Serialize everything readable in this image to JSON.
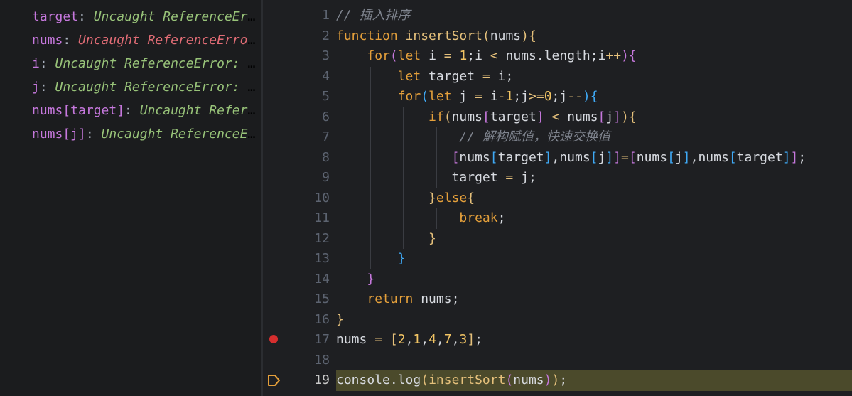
{
  "watch": [
    {
      "name": "target",
      "value": "Uncaught ReferenceError: target is not defined",
      "error": false
    },
    {
      "name": "nums",
      "value": "Uncaught ReferenceError: nums is not defined",
      "error": true
    },
    {
      "name": "i",
      "value": "Uncaught ReferenceError: i is not defined",
      "error": false
    },
    {
      "name": "j",
      "value": "Uncaught ReferenceError: j is not defined",
      "error": false
    },
    {
      "name": "nums[target]",
      "value": "Uncaught ReferenceError: nums is not defined",
      "error": false
    },
    {
      "name": "nums[j]",
      "value": "Uncaught ReferenceError: nums is not defined",
      "error": false
    }
  ],
  "editor": {
    "breakpoint_line": 17,
    "current_line": 19,
    "lines": [
      {
        "n": "1",
        "indent": 0,
        "tokens": [
          [
            "cm",
            "// 插入排序"
          ]
        ]
      },
      {
        "n": "2",
        "indent": 0,
        "tokens": [
          [
            "kw",
            "function "
          ],
          [
            "fn",
            "insertSort"
          ],
          [
            "br1",
            "("
          ],
          [
            "id",
            "nums"
          ],
          [
            "br1",
            ")"
          ],
          [
            "br1",
            "{"
          ]
        ]
      },
      {
        "n": "3",
        "indent": 4,
        "tokens": [
          [
            "kw",
            "for"
          ],
          [
            "br2",
            "("
          ],
          [
            "kw",
            "let "
          ],
          [
            "id",
            "i "
          ],
          [
            "op",
            "= "
          ],
          [
            "num",
            "1"
          ],
          [
            "id",
            ";i "
          ],
          [
            "op",
            "< "
          ],
          [
            "id",
            "nums.length;i"
          ],
          [
            "op",
            "++"
          ],
          [
            "br2",
            ")"
          ],
          [
            "br2",
            "{"
          ]
        ]
      },
      {
        "n": "4",
        "indent": 8,
        "tokens": [
          [
            "kw",
            "let "
          ],
          [
            "id",
            "target "
          ],
          [
            "op",
            "= "
          ],
          [
            "id",
            "i;"
          ]
        ]
      },
      {
        "n": "5",
        "indent": 8,
        "tokens": [
          [
            "kw",
            "for"
          ],
          [
            "br3",
            "("
          ],
          [
            "kw",
            "let "
          ],
          [
            "id",
            "j "
          ],
          [
            "op",
            "= "
          ],
          [
            "id",
            "i"
          ],
          [
            "op",
            "-"
          ],
          [
            "num",
            "1"
          ],
          [
            "id",
            ";j"
          ],
          [
            "op",
            ">="
          ],
          [
            "num",
            "0"
          ],
          [
            "id",
            ";j"
          ],
          [
            "op",
            "--"
          ],
          [
            "br3",
            ")"
          ],
          [
            "br3",
            "{"
          ]
        ]
      },
      {
        "n": "6",
        "indent": 12,
        "tokens": [
          [
            "kw",
            "if"
          ],
          [
            "br1",
            "("
          ],
          [
            "id",
            "nums"
          ],
          [
            "br2",
            "["
          ],
          [
            "id",
            "target"
          ],
          [
            "br2",
            "] "
          ],
          [
            "op",
            "< "
          ],
          [
            "id",
            "nums"
          ],
          [
            "br2",
            "["
          ],
          [
            "id",
            "j"
          ],
          [
            "br2",
            "]"
          ],
          [
            "br1",
            ")"
          ],
          [
            "br1",
            "{"
          ]
        ]
      },
      {
        "n": "7",
        "indent": 16,
        "tokens": [
          [
            "cm",
            "// 解构赋值，快速交换值"
          ]
        ]
      },
      {
        "n": "8",
        "indent": 15,
        "tokens": [
          [
            "br2",
            "["
          ],
          [
            "id",
            "nums"
          ],
          [
            "br3",
            "["
          ],
          [
            "id",
            "target"
          ],
          [
            "br3",
            "]"
          ],
          [
            "id",
            ",nums"
          ],
          [
            "br3",
            "["
          ],
          [
            "id",
            "j"
          ],
          [
            "br3",
            "]"
          ],
          [
            "br2",
            "]"
          ],
          [
            "op",
            "="
          ],
          [
            "br2",
            "["
          ],
          [
            "id",
            "nums"
          ],
          [
            "br3",
            "["
          ],
          [
            "id",
            "j"
          ],
          [
            "br3",
            "]"
          ],
          [
            "id",
            ",nums"
          ],
          [
            "br3",
            "["
          ],
          [
            "id",
            "target"
          ],
          [
            "br3",
            "]"
          ],
          [
            "br2",
            "]"
          ],
          [
            "id",
            ";"
          ]
        ]
      },
      {
        "n": "9",
        "indent": 15,
        "tokens": [
          [
            "id",
            "target "
          ],
          [
            "op",
            "= "
          ],
          [
            "id",
            "j;"
          ]
        ]
      },
      {
        "n": "10",
        "indent": 12,
        "tokens": [
          [
            "br1",
            "}"
          ],
          [
            "kw",
            "else"
          ],
          [
            "br1",
            "{"
          ]
        ]
      },
      {
        "n": "11",
        "indent": 16,
        "tokens": [
          [
            "kw",
            "break"
          ],
          [
            "id",
            ";"
          ]
        ]
      },
      {
        "n": "12",
        "indent": 12,
        "tokens": [
          [
            "br1",
            "}"
          ]
        ]
      },
      {
        "n": "13",
        "indent": 8,
        "tokens": [
          [
            "br3",
            "}"
          ]
        ]
      },
      {
        "n": "14",
        "indent": 4,
        "tokens": [
          [
            "br2",
            "}"
          ]
        ]
      },
      {
        "n": "15",
        "indent": 4,
        "tokens": [
          [
            "kw",
            "return "
          ],
          [
            "id",
            "nums;"
          ]
        ]
      },
      {
        "n": "16",
        "indent": 0,
        "tokens": [
          [
            "br1",
            "}"
          ]
        ]
      },
      {
        "n": "17",
        "indent": 0,
        "tokens": [
          [
            "id",
            "nums "
          ],
          [
            "op",
            "= "
          ],
          [
            "br1",
            "["
          ],
          [
            "num",
            "2"
          ],
          [
            "id",
            ","
          ],
          [
            "num",
            "1"
          ],
          [
            "id",
            ","
          ],
          [
            "num",
            "4"
          ],
          [
            "id",
            ","
          ],
          [
            "num",
            "7"
          ],
          [
            "id",
            ","
          ],
          [
            "num",
            "3"
          ],
          [
            "br1",
            "]"
          ],
          [
            "id",
            ";"
          ]
        ]
      },
      {
        "n": "18",
        "indent": 0,
        "tokens": []
      },
      {
        "n": "19",
        "indent": 0,
        "tokens": [
          [
            "id",
            "console.log"
          ],
          [
            "br1",
            "("
          ],
          [
            "fn",
            "insertSort"
          ],
          [
            "br2",
            "("
          ],
          [
            "id",
            "nums"
          ],
          [
            "br2",
            ")"
          ],
          [
            "br1",
            ")"
          ],
          [
            "id",
            ";"
          ]
        ]
      }
    ]
  },
  "colors": {
    "breakpoint": "#d62e2e",
    "current_line": "#4b4a2b",
    "debug_arrow": "#e5a03b"
  }
}
